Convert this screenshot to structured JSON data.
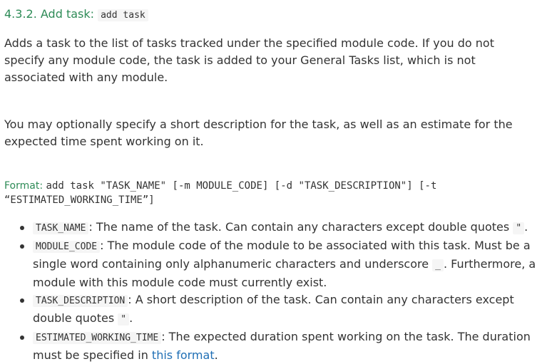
{
  "heading": {
    "number": "4.3.2. Add task: ",
    "command": "add task"
  },
  "para1": "Adds a task to the list of tasks tracked under the specified module code. If you do not specify any module code, the task is added to your General Tasks list, which is not associated with any module.",
  "para2": "You may optionally specify a short description for the task, as well as an estimate for the expected time spent working on it.",
  "format": {
    "label": "Format: ",
    "syntax": "add task \"TASK_NAME\" [-m MODULE_CODE] [-d \"TASK_DESCRIPTION\"] [-t “ESTIMATED_WORKING_TIME”]"
  },
  "params": [
    {
      "name": "TASK_NAME",
      "text1": ": The name of the task. Can contain any characters except double quotes ",
      "code2": "\"",
      "text2": "."
    },
    {
      "name": "MODULE_CODE",
      "text1": ": The module code of the module to be associated with this task. Must be a single word containing only alphanumeric characters and underscore ",
      "code2": "_",
      "text2": ". Furthermore, a module with this module code must currently exist."
    },
    {
      "name": "TASK_DESCRIPTION",
      "text1": ": A short description of the task. Can contain any characters except double quotes ",
      "code2": "\"",
      "text2": "."
    },
    {
      "name": "ESTIMATED_WORKING_TIME",
      "text1": ": The expected duration spent working on the task. The duration must be specified in ",
      "link": "this format",
      "text2": "."
    }
  ]
}
